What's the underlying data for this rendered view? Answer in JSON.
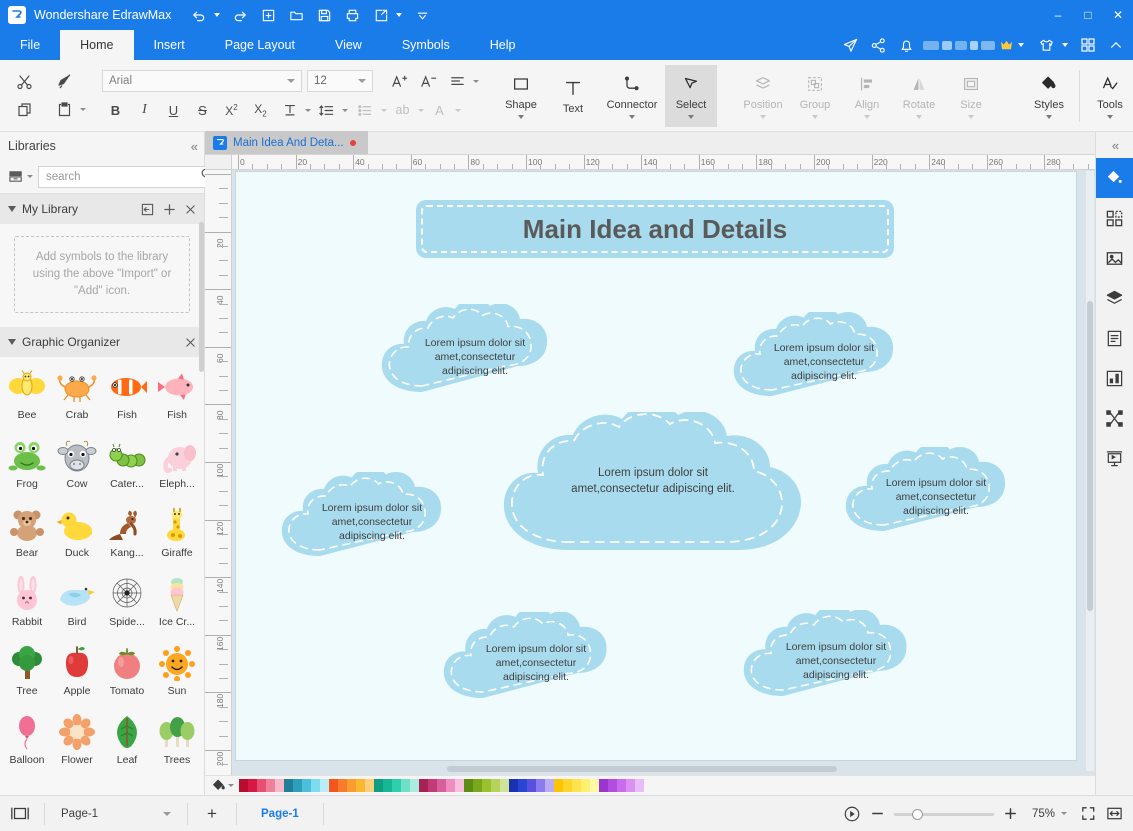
{
  "titlebar": {
    "app_name": "Wondershare EdrawMax",
    "logo_glyph": "Ɛ",
    "quick_access": [
      {
        "name": "undo",
        "icon": "undo-icon",
        "has_caret": true
      },
      {
        "name": "redo",
        "icon": "redo-icon",
        "has_caret": false
      },
      {
        "name": "new",
        "icon": "new-file-icon",
        "has_caret": false
      },
      {
        "name": "open",
        "icon": "folder-open-icon",
        "has_caret": false
      },
      {
        "name": "save",
        "icon": "save-icon",
        "has_caret": false
      },
      {
        "name": "print",
        "icon": "print-icon",
        "has_caret": false
      },
      {
        "name": "export",
        "icon": "export-icon",
        "has_caret": true
      },
      {
        "name": "customize",
        "icon": "chevron-down-icon",
        "has_caret": false
      }
    ],
    "window_controls": {
      "minimize": "–",
      "maximize": "□",
      "close": "✕"
    }
  },
  "ribbon_tabs": {
    "items": [
      {
        "label": "File",
        "active": false
      },
      {
        "label": "Home",
        "active": true
      },
      {
        "label": "Insert",
        "active": false
      },
      {
        "label": "Page Layout",
        "active": false
      },
      {
        "label": "View",
        "active": false
      },
      {
        "label": "Symbols",
        "active": false
      },
      {
        "label": "Help",
        "active": false
      }
    ],
    "right_icons": [
      {
        "name": "send-feedback-icon"
      },
      {
        "name": "share-icon"
      },
      {
        "name": "notification-bell-icon"
      }
    ],
    "account_blurred": true,
    "account_badge": "crown-icon",
    "theme_icon": "shirt-icon",
    "apps_icon": "grid-apps-icon",
    "collapse_icon": "chevron-up-icon"
  },
  "ribbon": {
    "clipboard": [
      {
        "name": "cut",
        "icon": "scissors-icon",
        "label": "Cut"
      },
      {
        "name": "format-painter",
        "icon": "format-painter-icon",
        "label": "Format Painter"
      },
      {
        "name": "copy",
        "icon": "copy-icon",
        "label": "Copy"
      },
      {
        "name": "paste",
        "icon": "paste-icon",
        "label": "Paste",
        "has_caret": true
      }
    ],
    "font_family": "Arial",
    "font_size": "12",
    "format_buttons": [
      {
        "name": "bold",
        "glyph": "B",
        "dim": false
      },
      {
        "name": "italic",
        "glyph": "I",
        "dim": false
      },
      {
        "name": "underline",
        "glyph": "U",
        "dim": false
      },
      {
        "name": "strikethrough",
        "glyph": "S",
        "dim": false
      },
      {
        "name": "superscript",
        "glyph": "X²",
        "dim": false
      },
      {
        "name": "subscript",
        "glyph": "X₂",
        "dim": false
      },
      {
        "name": "text-color",
        "glyph": "T",
        "dim": false,
        "has_caret": true
      },
      {
        "name": "line-spacing",
        "glyph": "↕",
        "dim": false,
        "has_caret": true
      },
      {
        "name": "grow-font",
        "glyph": "A⁺",
        "dim": false
      },
      {
        "name": "shrink-font",
        "glyph": "A⁻",
        "dim": false
      },
      {
        "name": "align",
        "glyph": "≡",
        "dim": false,
        "has_caret": true
      },
      {
        "name": "bullets",
        "glyph": "≔",
        "dim": true,
        "has_caret": true
      },
      {
        "name": "text-wrap",
        "glyph": "ab",
        "dim": true,
        "has_caret": true
      },
      {
        "name": "font-style",
        "glyph": "A",
        "dim": true,
        "has_caret": true
      }
    ],
    "tools": [
      {
        "name": "shape",
        "label": "Shape",
        "icon": "square-icon",
        "caret": true,
        "dim": false,
        "selected": false
      },
      {
        "name": "text",
        "label": "Text",
        "icon": "text-t-icon",
        "caret": false,
        "dim": false,
        "selected": false
      },
      {
        "name": "connector",
        "label": "Connector",
        "icon": "connector-icon",
        "caret": true,
        "dim": false,
        "selected": false
      },
      {
        "name": "select",
        "label": "Select",
        "icon": "cursor-arrow-icon",
        "caret": true,
        "dim": false,
        "selected": true
      }
    ],
    "arrange": [
      {
        "name": "position",
        "label": "Position",
        "icon": "layers-icon",
        "caret": true,
        "dim": true
      },
      {
        "name": "group",
        "label": "Group",
        "icon": "group-icon",
        "caret": true,
        "dim": true
      },
      {
        "name": "align",
        "label": "Align",
        "icon": "align-icon",
        "caret": true,
        "dim": true
      },
      {
        "name": "rotate",
        "label": "Rotate",
        "icon": "rotate-icon",
        "caret": true,
        "dim": true
      },
      {
        "name": "size",
        "label": "Size",
        "icon": "size-icon",
        "caret": true,
        "dim": true
      }
    ],
    "styles_group": [
      {
        "name": "styles",
        "label": "Styles",
        "icon": "paint-bucket-icon",
        "caret": true,
        "dim": false
      },
      {
        "name": "tools",
        "label": "Tools",
        "icon": "tools-check-icon",
        "caret": true,
        "dim": false
      }
    ]
  },
  "left_panel": {
    "title": "Libraries",
    "collapse_icon": "chevron-double-left-icon",
    "library_icon": "library-drawer-icon",
    "search": {
      "placeholder": "search",
      "value": "",
      "icon": "search-icon"
    },
    "nav_up_icon": "chevron-up-icon",
    "nav_down_icon": "chevron-down-icon",
    "sections": [
      {
        "title": "My Library",
        "actions": [
          "import-icon",
          "add-icon",
          "close-icon"
        ],
        "empty_message": "Add symbols to the library using the above \"Import\" or \"Add\" icon."
      },
      {
        "title": "Graphic Organizer",
        "actions": [
          "close-icon"
        ]
      }
    ],
    "symbols": [
      {
        "label": "Bee",
        "art": "bee"
      },
      {
        "label": "Crab",
        "art": "crab"
      },
      {
        "label": "Fish",
        "art": "clownfish"
      },
      {
        "label": "Fish",
        "art": "pinkfish"
      },
      {
        "label": "Frog",
        "art": "frog"
      },
      {
        "label": "Cow",
        "art": "cow"
      },
      {
        "label": "Cater...",
        "art": "caterpillar"
      },
      {
        "label": "Eleph...",
        "art": "elephant"
      },
      {
        "label": "Bear",
        "art": "bear"
      },
      {
        "label": "Duck",
        "art": "duck"
      },
      {
        "label": "Kang...",
        "art": "kangaroo"
      },
      {
        "label": "Giraffe",
        "art": "giraffe"
      },
      {
        "label": "Rabbit",
        "art": "rabbit"
      },
      {
        "label": "Bird",
        "art": "bird"
      },
      {
        "label": "Spide...",
        "art": "spiderweb"
      },
      {
        "label": "Ice Cr...",
        "art": "icecream"
      },
      {
        "label": "Tree",
        "art": "tree"
      },
      {
        "label": "Apple",
        "art": "apple"
      },
      {
        "label": "Tomato",
        "art": "tomato"
      },
      {
        "label": "Sun",
        "art": "sun"
      },
      {
        "label": "Balloon",
        "art": "balloon"
      },
      {
        "label": "Flower",
        "art": "flower"
      },
      {
        "label": "Leaf",
        "art": "leaf"
      },
      {
        "label": "Trees",
        "art": "trees"
      }
    ]
  },
  "document": {
    "tab_label": "Main Idea And Deta...",
    "tab_modified": true,
    "tab_icon": "edraw-doc-icon"
  },
  "rulers": {
    "unit_max_h": 300,
    "h_labels": [
      0,
      20,
      40,
      60,
      80,
      100,
      120,
      140,
      160,
      180,
      200,
      220,
      240,
      260,
      280
    ],
    "v_labels": [
      20,
      40,
      60,
      80,
      100,
      120,
      140,
      160,
      180,
      200
    ]
  },
  "diagram": {
    "title_shape": {
      "text": "Main Idea and Details",
      "fill": "#a9dbef",
      "text_color": "#5a5a5a"
    },
    "cloud_fill": "#a9dbef",
    "cloud_dash": "#ffffff",
    "clouds": [
      {
        "id": "cloud-top-left",
        "text": "Lorem ipsum dolor sit amet,consectetur adipiscing elit."
      },
      {
        "id": "cloud-top-right",
        "text": "Lorem ipsum dolor sit amet,consectetur adipiscing elit."
      },
      {
        "id": "cloud-mid-left",
        "text": "Lorem ipsum dolor sit amet,consectetur adipiscing elit."
      },
      {
        "id": "cloud-center",
        "text": "Lorem ipsum dolor sit amet,consectetur adipiscing elit."
      },
      {
        "id": "cloud-mid-right",
        "text": "Lorem ipsum dolor sit amet,consectetur adipiscing elit."
      },
      {
        "id": "cloud-bottom-left",
        "text": "Lorem ipsum dolor sit amet,consectetur adipiscing elit."
      },
      {
        "id": "cloud-bottom-right",
        "text": "Lorem ipsum dolor sit amet,consectetur adipiscing elit."
      }
    ],
    "cloud_lines": {
      "l1": "Lorem ipsum dolor sit",
      "l2": "amet,consectetur",
      "l3": "adipiscing elit.",
      "center_l1": "Lorem ipsum dolor sit",
      "center_l2": "amet,consectetur adipiscing elit."
    }
  },
  "palette": {
    "fill_icon": "paint-bucket-icon",
    "colors": [
      "#b80d2e",
      "#d81844",
      "#e85070",
      "#f07f9c",
      "#f7b8c8",
      "#1f7f96",
      "#2d9fbd",
      "#4cc0da",
      "#7fdcee",
      "#b8eef8",
      "#f4561e",
      "#f87c2b",
      "#fb9c2e",
      "#fcb731",
      "#fdd07a",
      "#0f9e82",
      "#17b694",
      "#2ccfae",
      "#6fe0c8",
      "#aaeddf",
      "#a62255",
      "#c23b77",
      "#d95e9c",
      "#ef8cc0",
      "#f8c0dd",
      "#5c8c14",
      "#7aa81c",
      "#99c22c",
      "#b5d45b",
      "#cfe498",
      "#1a32b0",
      "#2846d4",
      "#5a4fe0",
      "#8a7bee",
      "#b9aef5",
      "#ffc400",
      "#ffd42b",
      "#ffe24c",
      "#fff06f",
      "#fff9a8",
      "#9b35cf",
      "#b44ce0",
      "#c96bea",
      "#d992f1",
      "#e8bcf7"
    ]
  },
  "right_sidebar": {
    "collapse_icon": "chevron-double-right-icon",
    "items": [
      {
        "name": "fill-style-panel",
        "icon": "paint-bucket-icon",
        "active": true
      },
      {
        "name": "symbols-panel",
        "icon": "grid-squares-icon",
        "active": false
      },
      {
        "name": "image-panel",
        "icon": "picture-icon",
        "active": false
      },
      {
        "name": "layers-panel",
        "icon": "layers-icon",
        "active": false
      },
      {
        "name": "notes-panel",
        "icon": "document-list-icon",
        "active": false
      },
      {
        "name": "chart-panel",
        "icon": "chart-blocks-icon",
        "active": false
      },
      {
        "name": "connector-panel",
        "icon": "node-connect-icon",
        "active": false
      },
      {
        "name": "presentation-panel",
        "icon": "presentation-icon",
        "active": false
      }
    ]
  },
  "statusbar": {
    "view_icon": "page-view-icon",
    "page_select": "Page-1",
    "add_page_icon": "plus-icon",
    "page_tab": "Page-1",
    "play_icon": "play-circle-icon",
    "zoom_out_icon": "minus-icon",
    "zoom_in_icon": "plus-icon",
    "zoom_level": "75%",
    "zoom_caret": "chevron-down-icon",
    "fullscreen_icon": "fullscreen-icon",
    "fit-width_icon": "fit-width-icon"
  }
}
